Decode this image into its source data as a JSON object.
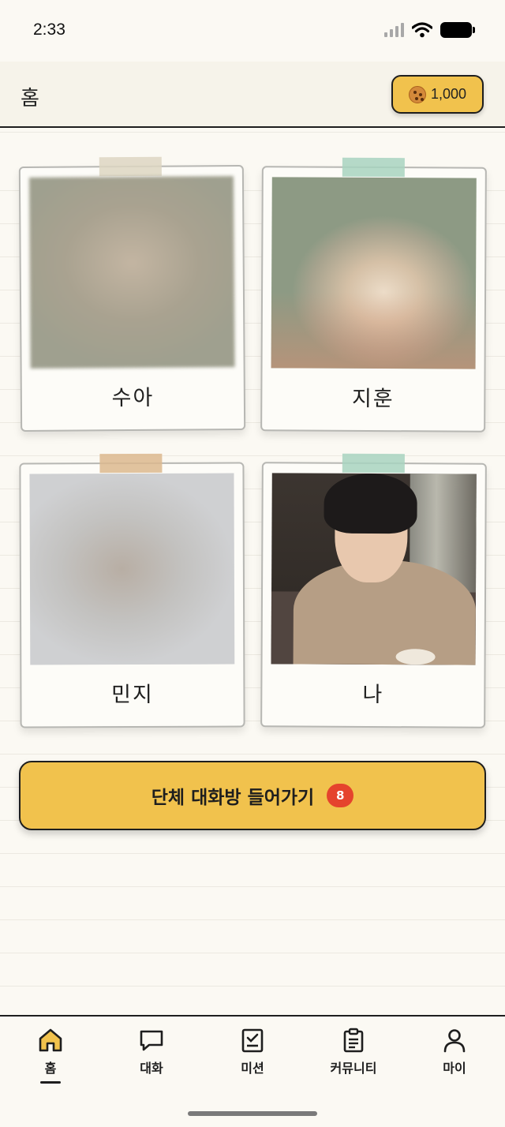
{
  "status_bar": {
    "time": "2:33"
  },
  "header": {
    "title": "홈",
    "cookie_count": "1,000",
    "cookie_icon": "cookie-icon"
  },
  "members": [
    {
      "name": "수아",
      "tape_color": "#ddd6c2"
    },
    {
      "name": "지훈",
      "tape_color": "#a8d3c0"
    },
    {
      "name": "민지",
      "tape_color": "#dcb88e"
    },
    {
      "name": "나",
      "tape_color": "#a8d3c0"
    }
  ],
  "group_chat": {
    "label": "단체 대화방 들어가기",
    "unread_count": "8",
    "accent": "#f1c24d",
    "badge_color": "#e5432d"
  },
  "tabs": [
    {
      "label": "홈",
      "icon": "home-icon",
      "active": true
    },
    {
      "label": "대화",
      "icon": "chat-bubble-icon",
      "active": false
    },
    {
      "label": "미션",
      "icon": "checklist-icon",
      "active": false
    },
    {
      "label": "커뮤니티",
      "icon": "clipboard-icon",
      "active": false
    },
    {
      "label": "마이",
      "icon": "person-icon",
      "active": false
    }
  ]
}
